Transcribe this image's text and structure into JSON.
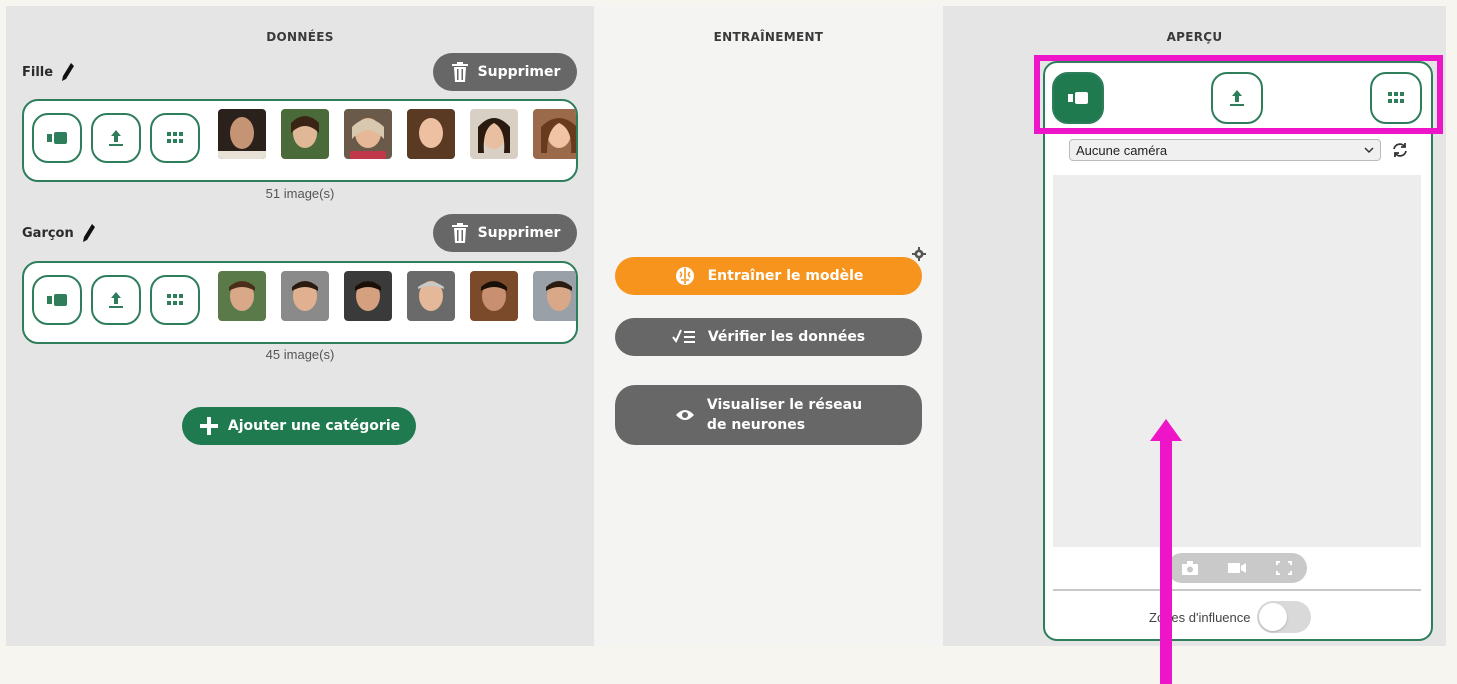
{
  "left_panel": {
    "title": "DONNÉES",
    "add_category_label": "Ajouter une catégorie",
    "categories": [
      {
        "name": "Fille",
        "delete_label": "Supprimer",
        "count_label": "51 image(s)"
      },
      {
        "name": "Garçon",
        "delete_label": "Supprimer",
        "count_label": "45 image(s)"
      }
    ]
  },
  "middle_panel": {
    "title": "ENTRAÎNEMENT",
    "train_label": "Entraîner le modèle",
    "verify_label": "Vérifier les données",
    "visualize_line1": "Visualiser le réseau",
    "visualize_line2": "de neurones"
  },
  "right_panel": {
    "title": "APERÇU",
    "camera_select_value": "Aucune caméra",
    "zones_label": "Zones d'influence",
    "zones_enabled": false
  },
  "icons": {
    "webcam": "webcam-icon",
    "upload": "upload-icon",
    "grid": "grid-icon",
    "pencil": "pencil-icon",
    "trash": "trash-icon",
    "gear": "gear-icon",
    "refresh": "refresh-icon",
    "camera": "camera-icon",
    "video": "video-icon",
    "fullscreen": "fullscreen-icon",
    "plus": "plus-icon",
    "brain": "brain-icon",
    "checklist": "checklist-icon",
    "eye": "eye-icon"
  },
  "colors": {
    "green": "#1f7a4f",
    "orange": "#f7941d",
    "gray_button": "#676767",
    "highlight": "#ee14c8"
  }
}
